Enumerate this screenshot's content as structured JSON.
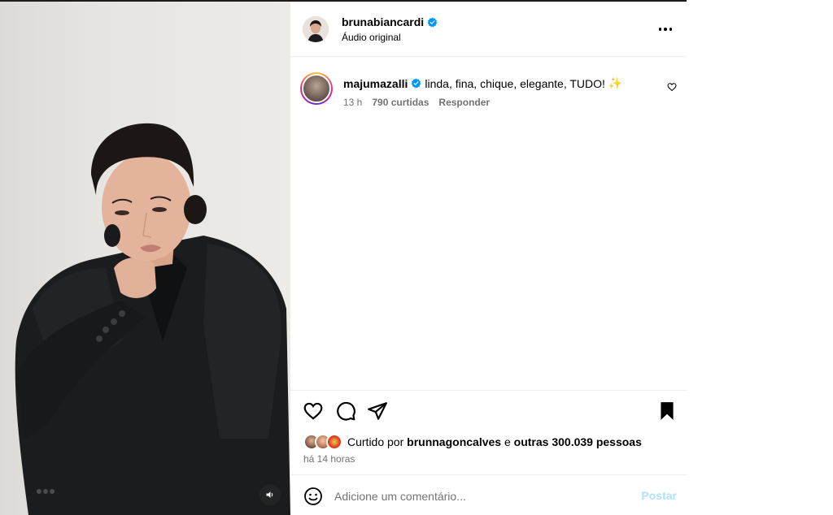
{
  "post": {
    "author": "brunabiancardi",
    "audio": "Áudio original"
  },
  "comment": {
    "user": "majumazalli",
    "text": "linda, fina, chique, elegante, TUDO!",
    "emoji": "✨",
    "time": "13 h",
    "likes": "790 curtidas",
    "reply_label": "Responder"
  },
  "likes": {
    "prefix": "Curtido por",
    "user": "brunnagoncalves",
    "and": "e",
    "others": "outras 300.039 pessoas"
  },
  "timestamp": "há 14 horas",
  "composer": {
    "placeholder": "Adicione um comentário...",
    "post_label": "Postar"
  },
  "colors": {
    "verified": "#0095f6",
    "muted_text": "#737373",
    "post_disabled": "#b2dffc",
    "jacket": "#1b1c1e"
  },
  "icons": [
    "verified-icon",
    "more-icon",
    "heart-icon",
    "comment-icon",
    "share-icon",
    "bookmark-icon",
    "emoji-icon",
    "volume-icon"
  ]
}
